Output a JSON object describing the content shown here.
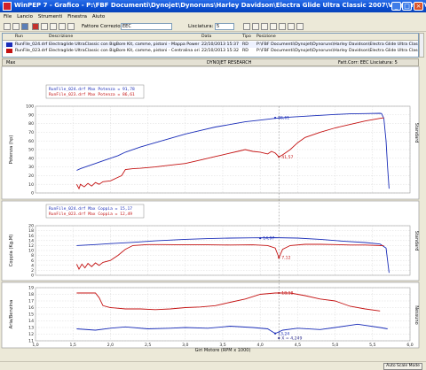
{
  "window": {
    "title": "WinPEP 7  -  Grafico - P:\\FBF Documenti\\Dynojet\\Dynoruns\\Harley Davidson\\Electra Glide Ultra Classic 2007\\Vrignani FVL"
  },
  "menu": [
    "File",
    "Lancio",
    "Strumenti",
    "Finestra",
    "Aiuto"
  ],
  "toolbar": {
    "correction_label": "Fattore Correzione:",
    "correction_value": "EEC",
    "smoothing_label": "Lisciatura:",
    "smoothing_value": "5"
  },
  "file_table": {
    "headers": [
      "Run",
      "Descrizione",
      "Data",
      "Tipo",
      "Posizione"
    ],
    "rows": [
      {
        "run": "RunFile_024.drf",
        "desc": "Electraglide UltraClassic con BigBore Kit, camme, pistoni - Mappa Power Vision",
        "date": "22/10/2013 15:37",
        "type": "RD",
        "pos": "P:\\FBF Documenti\\Dynojet\\Dynoruns\\Harley Davidson\\Electra Glide Ultra Classic 2007\\"
      },
      {
        "run": "RunFile_023.drf",
        "desc": "Electraglide UltraClassic con BigBore Kit, camme, pistoni - Centralina originale",
        "date": "22/10/2013 15:32",
        "type": "RD",
        "pos": "P:\\FBF Documenti\\Dynojet\\Dynoruns\\Harley Davidson\\Electra Glide Ultra Classic 2007\\"
      }
    ]
  },
  "chart_header": {
    "left": "Max",
    "center": "DYNOJET RESEARCH",
    "subcenter": "Foster 96  Italy",
    "right": "Fatt.Corr: EEC  Lisciatura: 5"
  },
  "colors": {
    "run1": "#1a2db8",
    "run2": "#c41212",
    "annot": "#2a2a8a"
  },
  "chart_data": [
    {
      "type": "line",
      "ylabel": "Potenza (hp)",
      "right_label": "Standard",
      "xlim": [
        1.0,
        6.0
      ],
      "ylim": [
        0,
        100
      ],
      "ytick_values": [
        0,
        10,
        20,
        30,
        40,
        50,
        60,
        70,
        80,
        90,
        100
      ],
      "legend": [
        "RunFile_024.drf Max Potenza = 91,78",
        "RunFile_023.drf Max Potenza = 86,61"
      ],
      "annotations": [
        {
          "text": "86,61",
          "x": 4.2,
          "y": 86.6,
          "color": "run1"
        },
        {
          "text": "41,57",
          "x": 4.25,
          "y": 41.57,
          "color": "run2"
        }
      ],
      "series": [
        {
          "name": "RunFile_024.drf",
          "color": "run1",
          "x": [
            1.55,
            1.6,
            1.7,
            1.8,
            1.9,
            2.0,
            2.1,
            2.2,
            2.4,
            2.6,
            2.8,
            3.0,
            3.2,
            3.4,
            3.6,
            3.8,
            4.0,
            4.2,
            4.4,
            4.6,
            4.8,
            5.0,
            5.2,
            5.4,
            5.6,
            5.62,
            5.65,
            5.68,
            5.7,
            5.72
          ],
          "y": [
            26,
            28,
            31,
            34,
            37,
            40,
            43,
            47,
            53,
            58,
            63,
            68,
            72,
            76,
            79,
            82,
            84,
            86,
            87.5,
            88.5,
            89.5,
            90.5,
            91.2,
            91.5,
            91.8,
            91.5,
            86,
            60,
            30,
            5
          ]
        },
        {
          "name": "RunFile_023.drf",
          "color": "run2",
          "x": [
            1.55,
            1.58,
            1.6,
            1.65,
            1.7,
            1.75,
            1.8,
            1.85,
            1.9,
            2.0,
            2.1,
            2.15,
            2.2,
            2.3,
            2.4,
            2.6,
            2.8,
            3.0,
            3.2,
            3.4,
            3.5,
            3.6,
            3.7,
            3.8,
            3.9,
            4.0,
            4.1,
            4.15,
            4.2,
            4.25,
            4.3,
            4.4,
            4.5,
            4.6,
            4.8,
            5.0,
            5.2,
            5.4,
            5.6,
            5.65
          ],
          "y": [
            10,
            5,
            10,
            7,
            11,
            8,
            12,
            10,
            13,
            14,
            18,
            20,
            27,
            28,
            28.5,
            30,
            32,
            34,
            38,
            42,
            44,
            46,
            48,
            50,
            48,
            47,
            45,
            48,
            46,
            41.6,
            44,
            50,
            58,
            64,
            70,
            75,
            79,
            83,
            86,
            86.6
          ]
        }
      ]
    },
    {
      "type": "line",
      "ylabel": "Coppia (Kg.M)",
      "right_label": "Standard",
      "xlim": [
        1.0,
        6.0
      ],
      "ylim": [
        0,
        20
      ],
      "ytick_values": [
        0,
        2,
        4,
        6,
        8,
        10,
        12,
        14,
        16,
        18,
        20
      ],
      "legend": [
        "RunFile_024.drf Max Coppia = 15,17",
        "RunFile_023.drf Max Coppia = 12,49"
      ],
      "annotations": [
        {
          "text": "14,97",
          "x": 4.0,
          "y": 14.97,
          "color": "run1"
        },
        {
          "text": "7,12",
          "x": 4.25,
          "y": 7.12,
          "color": "run2"
        }
      ],
      "series": [
        {
          "name": "RunFile_024.drf",
          "color": "run1",
          "x": [
            1.55,
            1.8,
            2.0,
            2.3,
            2.6,
            3.0,
            3.3,
            3.6,
            3.9,
            4.2,
            4.5,
            4.8,
            5.1,
            5.4,
            5.6,
            5.68,
            5.7,
            5.72
          ],
          "y": [
            12,
            12.4,
            12.8,
            13.3,
            13.9,
            14.5,
            14.8,
            15.0,
            15.1,
            15.17,
            15.0,
            14.5,
            13.8,
            13.2,
            12.6,
            11,
            6,
            1
          ]
        },
        {
          "name": "RunFile_023.drf",
          "color": "run2",
          "x": [
            1.55,
            1.58,
            1.62,
            1.66,
            1.7,
            1.75,
            1.8,
            1.85,
            1.9,
            2.0,
            2.1,
            2.2,
            2.3,
            2.5,
            2.7,
            3.0,
            3.3,
            3.6,
            3.9,
            4.1,
            4.2,
            4.25,
            4.3,
            4.4,
            4.6,
            4.8,
            5.0,
            5.2,
            5.4,
            5.6,
            5.65
          ],
          "y": [
            4.5,
            2.5,
            4.5,
            3.0,
            4.8,
            3.5,
            5.0,
            4.0,
            5.2,
            6.0,
            8.0,
            10.5,
            12.0,
            12.4,
            12.4,
            12.3,
            12.3,
            12.2,
            12.3,
            12.0,
            11.0,
            7.12,
            10.5,
            12.0,
            12.5,
            12.49,
            12.4,
            12.2,
            12.2,
            12.0,
            12.0
          ]
        }
      ]
    },
    {
      "type": "line",
      "ylabel": "Aria/Benzina",
      "right_label": "Nessuno",
      "xlim": [
        1.0,
        6.0
      ],
      "xlabel": "Giri Motore (RPM x 1000)",
      "xtick_values": [
        1.0,
        1.5,
        2.0,
        2.5,
        3.0,
        3.5,
        4.0,
        4.5,
        5.0,
        5.5,
        6.0
      ],
      "xtick_labels": [
        "1,0",
        "1,5",
        "2,0",
        "2,5",
        "3,0",
        "3,5",
        "4,0",
        "4,5",
        "5,0",
        "5,5",
        "6,0"
      ],
      "ylim": [
        11,
        19
      ],
      "ytick_values": [
        11,
        12,
        13,
        14,
        15,
        16,
        17,
        18,
        19
      ],
      "annotations": [
        {
          "text": "18,18",
          "x": 4.25,
          "y": 18.2,
          "color": "run2"
        },
        {
          "text": "13,24",
          "x": 4.2,
          "y": 12.1,
          "color": "run1"
        },
        {
          "text": "X = 4,249",
          "x": 4.25,
          "y": 11.4,
          "color": "annot"
        }
      ],
      "series": [
        {
          "name": "RunFile_024.drf",
          "color": "run1",
          "x": [
            1.55,
            1.8,
            2.0,
            2.2,
            2.5,
            2.8,
            3.0,
            3.3,
            3.6,
            3.9,
            4.1,
            4.2,
            4.3,
            4.5,
            4.8,
            5.0,
            5.3,
            5.6,
            5.7
          ],
          "y": [
            12.8,
            12.6,
            12.9,
            13.1,
            12.8,
            12.9,
            13.0,
            12.9,
            13.2,
            13.0,
            12.8,
            12.1,
            12.6,
            12.9,
            12.7,
            13.0,
            13.5,
            13.0,
            12.8
          ]
        },
        {
          "name": "RunFile_023.drf",
          "color": "run2",
          "x": [
            1.55,
            1.8,
            1.85,
            1.9,
            2.0,
            2.2,
            2.4,
            2.6,
            2.8,
            3.0,
            3.2,
            3.4,
            3.6,
            3.8,
            4.0,
            4.2,
            4.4,
            4.6,
            4.8,
            5.0,
            5.2,
            5.4,
            5.6
          ],
          "y": [
            18.2,
            18.2,
            17.5,
            16.3,
            16.0,
            15.8,
            15.8,
            15.7,
            15.8,
            16.0,
            16.1,
            16.3,
            16.8,
            17.3,
            18.0,
            18.2,
            18.2,
            17.8,
            17.3,
            17.0,
            16.2,
            15.8,
            15.5
          ]
        }
      ]
    }
  ],
  "status": {
    "auto_scale": "Auto Scale Mode"
  }
}
